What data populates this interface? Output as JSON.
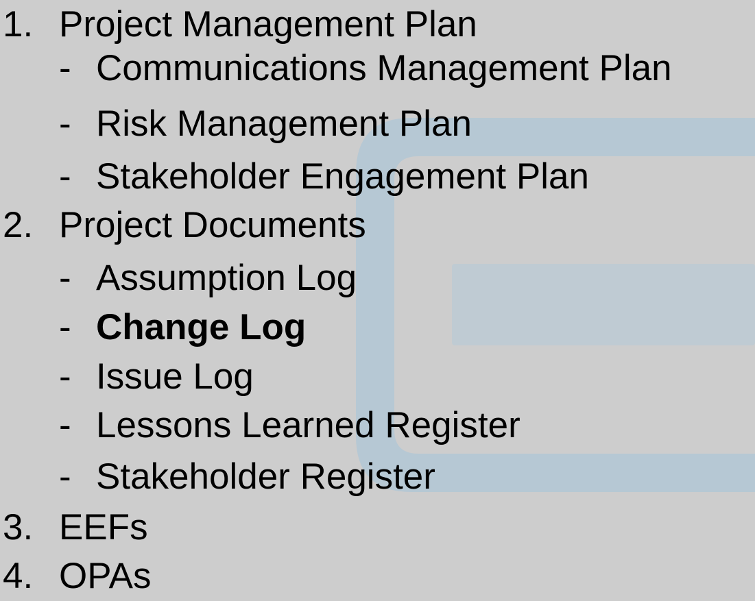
{
  "background": {
    "color": "#cdcdcd",
    "decoration_color": "#b6c8d4"
  },
  "outline": [
    {
      "number": "1.",
      "label": "Project Management Plan",
      "children": [
        {
          "marker": "-",
          "label": "Communications Management Plan"
        },
        {
          "marker": "-",
          "label": "Risk Management Plan"
        },
        {
          "marker": "-",
          "label": "Stakeholder Engagement Plan"
        }
      ]
    },
    {
      "number": "2.",
      "label": "Project Documents",
      "children": [
        {
          "marker": "-",
          "label": "Assumption Log"
        },
        {
          "marker": "-",
          "label": "Change Log",
          "emphasized": true
        },
        {
          "marker": "-",
          "label": "Issue Log"
        },
        {
          "marker": "-",
          "label": "Lessons Learned Register"
        },
        {
          "marker": "-",
          "label": "Stakeholder Register"
        }
      ]
    },
    {
      "number": "3.",
      "label": "EEFs",
      "children": []
    },
    {
      "number": "4.",
      "label": "OPAs",
      "children": []
    }
  ]
}
